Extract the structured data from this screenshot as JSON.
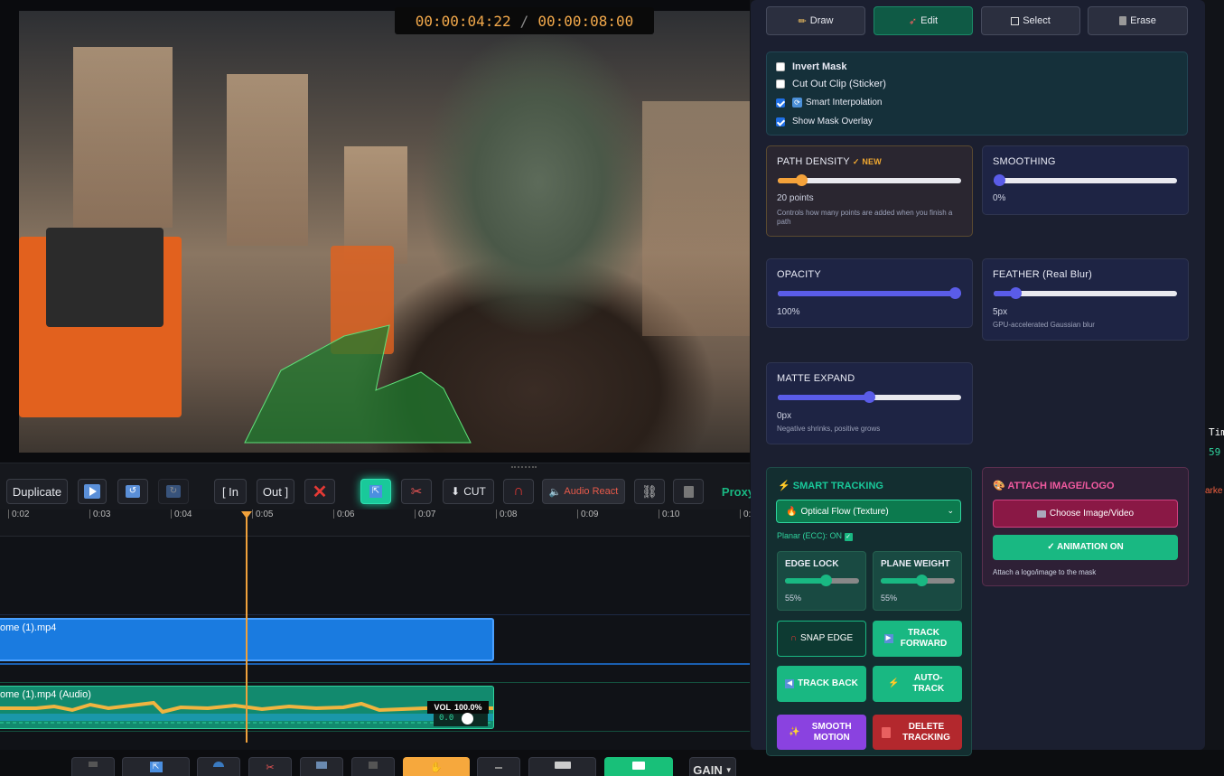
{
  "preview": {
    "timecode_current": "00:00:04:22",
    "timecode_separator": "/",
    "timecode_total": "00:00:08:00"
  },
  "sidestrip": {
    "label_top": "Tim",
    "label_value": "59",
    "label_marker": "arke"
  },
  "toolbar": {
    "duplicate": "Duplicate",
    "in": "[ In",
    "out": "Out ]",
    "cut": "CUT",
    "audio_react": "Audio React",
    "proxy": "Proxy"
  },
  "ruler": {
    "ticks": [
      "0:02",
      "0:03",
      "0:04",
      "0:05",
      "0:06",
      "0:07",
      "0:08",
      "0:09",
      "0:10",
      "0:"
    ]
  },
  "clips": {
    "video_name": "ome (1).mp4",
    "audio_name": "ome (1).mp4 (Audio)",
    "vol_label": "VOL",
    "vol_value": "100.0%",
    "vol_slider_value": "0.0"
  },
  "bottombar": {
    "gain": "GAIN"
  },
  "panel": {
    "modes": {
      "draw": "Draw",
      "edit": "Edit",
      "select": "Select",
      "erase": "Erase"
    },
    "options": {
      "invert_mask": "Invert Mask",
      "cut_out_clip": "Cut Out Clip (Sticker)",
      "smart_interpolation": "Smart Interpolation",
      "show_mask_overlay": "Show Mask Overlay"
    },
    "path_density": {
      "label": "PATH DENSITY",
      "badge": "✓ NEW",
      "value": "20 points",
      "hint": "Controls how many points are added when you finish a path",
      "level": 0.13
    },
    "smoothing": {
      "label": "SMOOTHING",
      "value": "0%",
      "level": 0.0
    },
    "opacity": {
      "label": "OPACITY",
      "value": "100%",
      "level": 1.0
    },
    "feather": {
      "label": "FEATHER (Real Blur)",
      "value": "5px",
      "hint": "GPU-accelerated Gaussian blur",
      "level": 0.12
    },
    "matte_expand": {
      "label": "MATTE EXPAND",
      "value": "0px",
      "hint": "Negative shrinks, positive grows",
      "level": 0.5
    },
    "tracking": {
      "title": "SMART TRACKING",
      "method": "Optical Flow (Texture)",
      "planar": "Planar (ECC): ON",
      "edge_lock": {
        "label": "EDGE LOCK",
        "value": "55%",
        "level": 0.55
      },
      "plane_weight": {
        "label": "PLANE WEIGHT",
        "value": "55%",
        "level": 0.55
      },
      "snap_edge": "SNAP EDGE",
      "track_forward": "TRACK FORWARD",
      "track_back": "TRACK BACK",
      "auto_track": "AUTO-TRACK",
      "smooth_motion": "SMOOTH MOTION",
      "delete_tracking": "DELETE TRACKING"
    },
    "attach": {
      "title": "ATTACH IMAGE/LOGO",
      "choose": "Choose Image/Video",
      "animation": "✓ ANIMATION ON",
      "hint": "Attach a logo/image to the mask"
    }
  },
  "colors": {
    "accent": "#5a5ce8",
    "orange": "#f4a23a",
    "green": "#19b882",
    "danger": "#e53935",
    "panel": "#1b1f30"
  }
}
